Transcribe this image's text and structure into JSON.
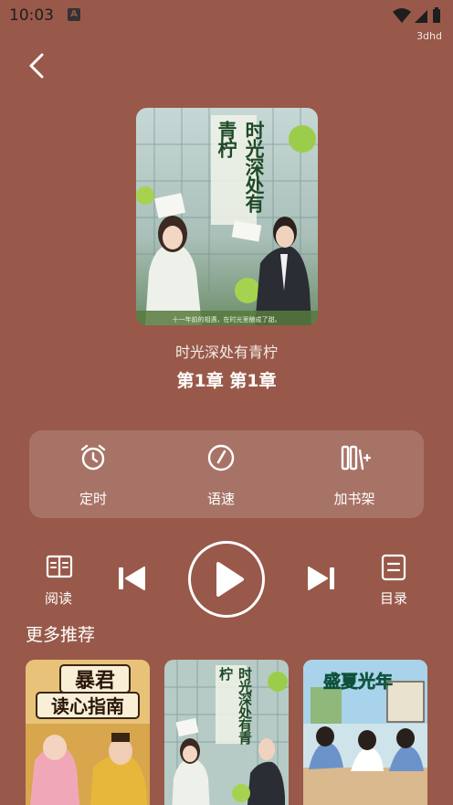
{
  "status_bar": {
    "time": "10:03",
    "app_badge": "A",
    "label": "3dhd"
  },
  "cover": {
    "title_art": "时光深处有青柠",
    "caption": "十一年前的相遇，在时光里酿成了甜。"
  },
  "book": {
    "title": "时光深处有青柠",
    "chapter": "第1章  第1章"
  },
  "panel": {
    "timer_label": "定时",
    "speed_label": "语速",
    "shelf_label": "加书架"
  },
  "controls": {
    "read_label": "阅读",
    "toc_label": "目录"
  },
  "recommend": {
    "title": "更多推荐",
    "items": [
      {
        "art_title_1": "暴君",
        "art_title_2": "读心指南"
      },
      {
        "art_title_1": "时光深处有青柠"
      },
      {
        "art_title_1": "盛夏光年"
      }
    ]
  },
  "colors": {
    "background": "#98594a",
    "panel": "rgba(255,255,255,0.16)",
    "text": "#ffffff"
  }
}
